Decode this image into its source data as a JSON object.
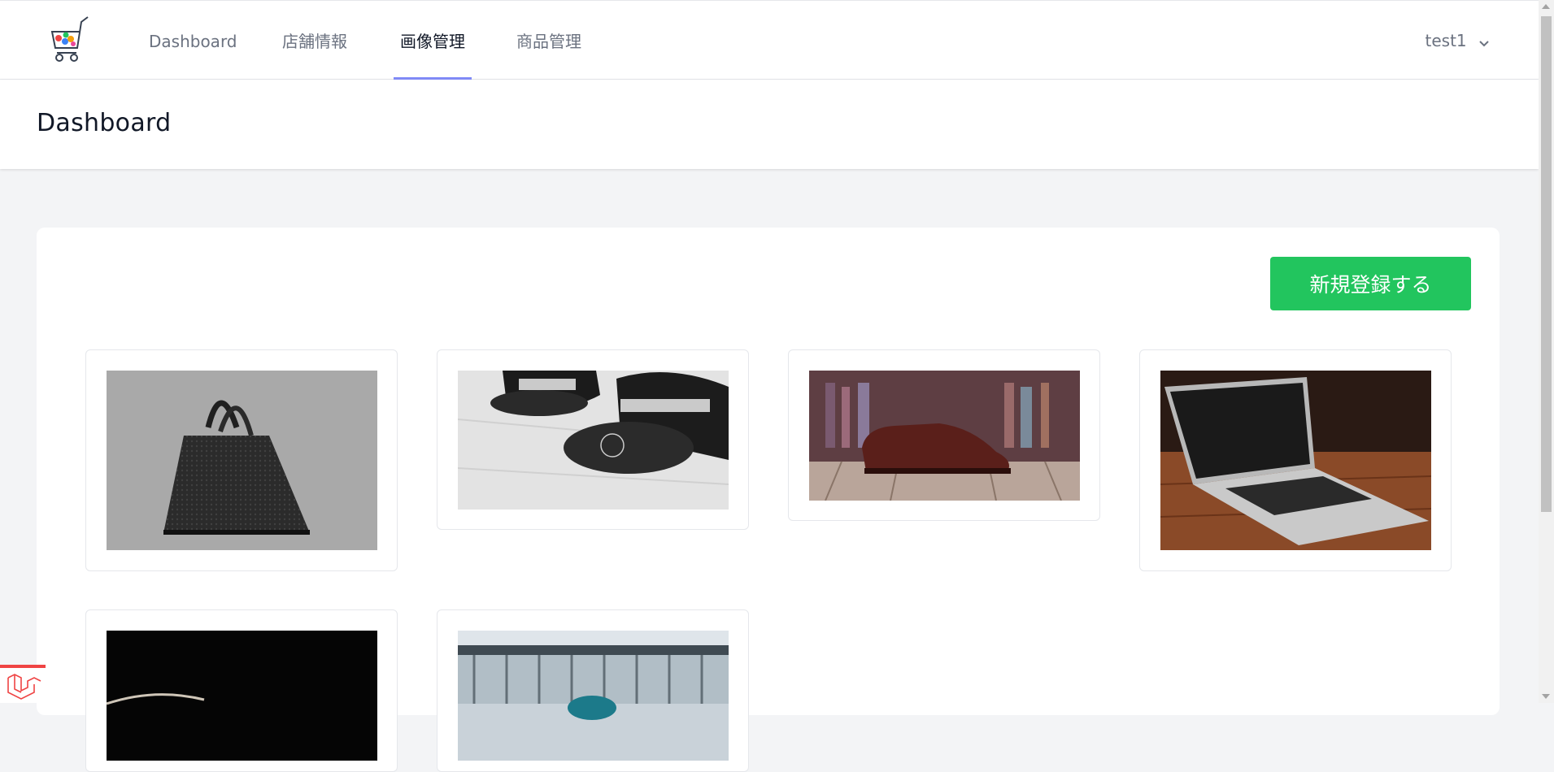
{
  "nav": {
    "logo_icon": "shopping-cart-logo-icon",
    "links": [
      {
        "label": "Dashboard",
        "active": false
      },
      {
        "label": "店舗情報",
        "active": false
      },
      {
        "label": "画像管理",
        "active": true
      },
      {
        "label": "商品管理",
        "active": false
      }
    ],
    "user": {
      "name": "test1",
      "icon": "chevron-down-icon"
    },
    "active_color": "#818cf8"
  },
  "header": {
    "title": "Dashboard"
  },
  "main": {
    "new_button_label": "新規登録する",
    "new_button_color": "#22c55e",
    "images": [
      {
        "subject": "black-handbag-image"
      },
      {
        "subject": "black-caps-image"
      },
      {
        "subject": "brown-leather-shoe-image"
      },
      {
        "subject": "laptop-image"
      },
      {
        "subject": "dark-image"
      },
      {
        "subject": "stadium-ball-image"
      }
    ]
  },
  "footer_badge": {
    "icon": "laravel-logo-icon"
  }
}
